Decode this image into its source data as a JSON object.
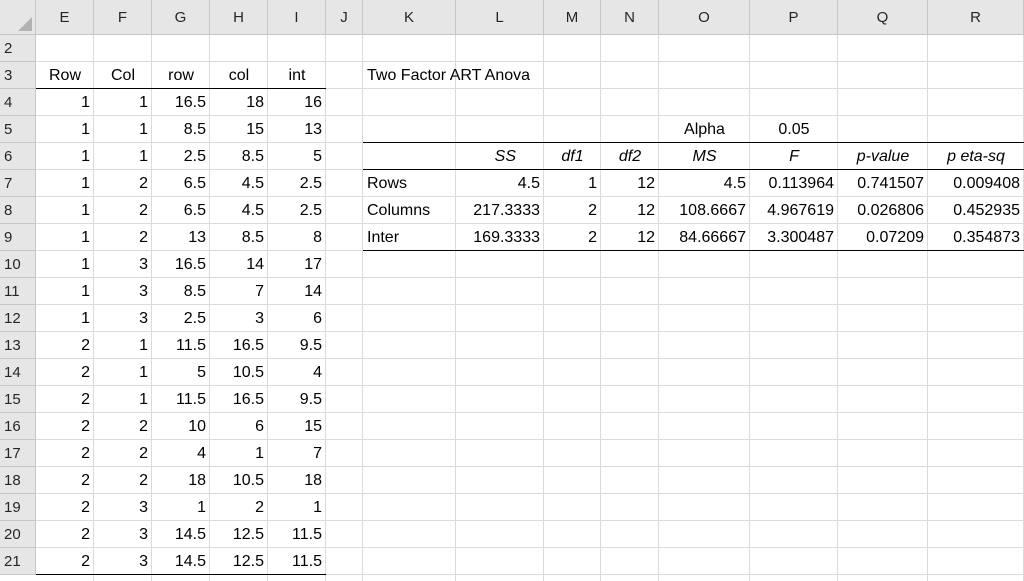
{
  "columns": [
    "E",
    "F",
    "G",
    "H",
    "I",
    "J",
    "K",
    "L",
    "M",
    "N",
    "O",
    "P",
    "Q",
    "R"
  ],
  "rows": [
    "2",
    "3",
    "4",
    "5",
    "6",
    "7",
    "8",
    "9",
    "10",
    "11",
    "12",
    "13",
    "14",
    "15",
    "16",
    "17",
    "18",
    "19",
    "20",
    "21"
  ],
  "left_table": {
    "headers": [
      "Row",
      "Col",
      "row",
      "col",
      "int"
    ],
    "data": [
      [
        "1",
        "1",
        "16.5",
        "18",
        "16"
      ],
      [
        "1",
        "1",
        "8.5",
        "15",
        "13"
      ],
      [
        "1",
        "1",
        "2.5",
        "8.5",
        "5"
      ],
      [
        "1",
        "2",
        "6.5",
        "4.5",
        "2.5"
      ],
      [
        "1",
        "2",
        "6.5",
        "4.5",
        "2.5"
      ],
      [
        "1",
        "2",
        "13",
        "8.5",
        "8"
      ],
      [
        "1",
        "3",
        "16.5",
        "14",
        "17"
      ],
      [
        "1",
        "3",
        "8.5",
        "7",
        "14"
      ],
      [
        "1",
        "3",
        "2.5",
        "3",
        "6"
      ],
      [
        "2",
        "1",
        "11.5",
        "16.5",
        "9.5"
      ],
      [
        "2",
        "1",
        "5",
        "10.5",
        "4"
      ],
      [
        "2",
        "1",
        "11.5",
        "16.5",
        "9.5"
      ],
      [
        "2",
        "2",
        "10",
        "6",
        "15"
      ],
      [
        "2",
        "2",
        "4",
        "1",
        "7"
      ],
      [
        "2",
        "2",
        "18",
        "10.5",
        "18"
      ],
      [
        "2",
        "3",
        "1",
        "2",
        "1"
      ],
      [
        "2",
        "3",
        "14.5",
        "12.5",
        "11.5"
      ],
      [
        "2",
        "3",
        "14.5",
        "12.5",
        "11.5"
      ]
    ]
  },
  "anova": {
    "title": "Two Factor ART Anova",
    "alpha_label": "Alpha",
    "alpha_value": "0.05",
    "headers": [
      "SS",
      "df1",
      "df2",
      "MS",
      "F",
      "p-value",
      "p eta-sq"
    ],
    "rows": [
      {
        "label": "Rows",
        "values": [
          "4.5",
          "1",
          "12",
          "4.5",
          "0.113964",
          "0.741507",
          "0.009408"
        ]
      },
      {
        "label": "Columns",
        "values": [
          "217.3333",
          "2",
          "12",
          "108.6667",
          "4.967619",
          "0.026806",
          "0.452935"
        ]
      },
      {
        "label": "Inter",
        "values": [
          "169.3333",
          "2",
          "12",
          "84.66667",
          "3.300487",
          "0.07209",
          "0.354873"
        ]
      }
    ]
  }
}
